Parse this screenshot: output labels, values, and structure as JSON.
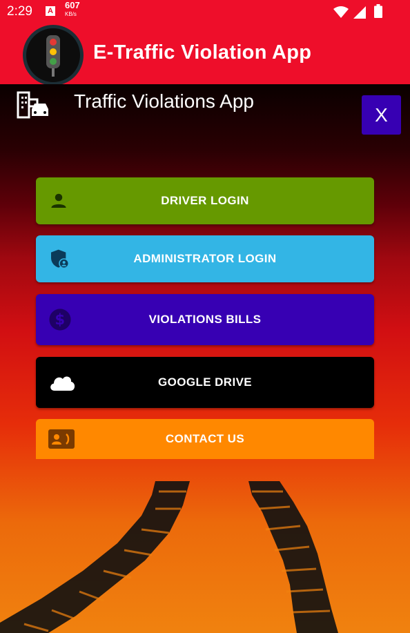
{
  "status_bar": {
    "time": "2:29",
    "notification_badge": "A",
    "speed_value": "607",
    "speed_unit": "KB/s"
  },
  "app_bar": {
    "title": "E-Traffic Violation App",
    "logo_icon": "traffic-light-icon"
  },
  "header": {
    "icon": "city-car-icon",
    "subtitle": "Traffic Violations App",
    "close_label": "X"
  },
  "menu": {
    "driver_login": "DRIVER LOGIN",
    "admin_login": "ADMINISTRATOR LOGIN",
    "violations_bills": "VIOLATIONS BILLS",
    "google_drive": "GOOGLE DRIVE",
    "contact_us": "CONTACT US"
  },
  "colors": {
    "app_bar": "#ee0e2a",
    "driver": "#669900",
    "admin": "#33b5e5",
    "bills": "#3700b3",
    "drive": "#000000",
    "contact": "#ff8800"
  }
}
